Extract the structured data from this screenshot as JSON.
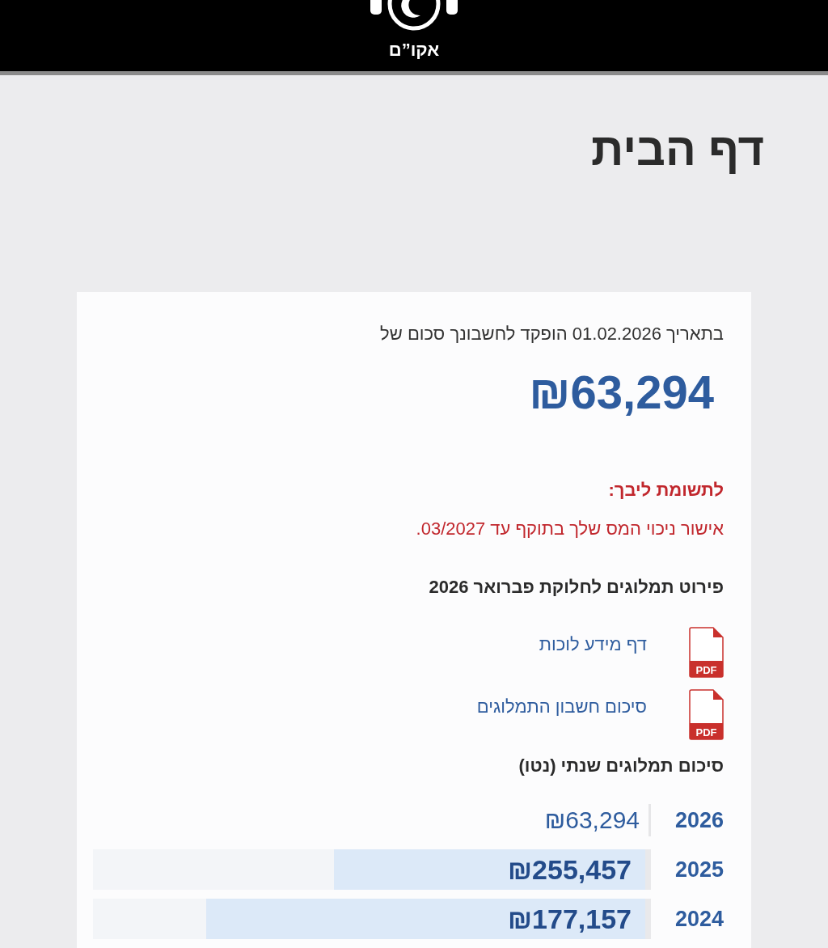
{
  "header": {
    "logo_text": "אקו”ם"
  },
  "page_title": "דף הבית",
  "deposit": {
    "text": "בתאריך 01.02.2026 הופקד לחשבונך סכום של",
    "amount": "₪63,294"
  },
  "notice": {
    "title": "לתשומת ליבך:",
    "text": "אישור ניכוי המס שלך בתוקף עד 03/2027."
  },
  "documents": {
    "title": "פירוט תמלוגים לחלוקת פברואר 2026",
    "items": [
      {
        "label": "דף מידע לוכות",
        "badge": "PDF"
      },
      {
        "label": "סיכום חשבון התמלוגים",
        "badge": "PDF"
      }
    ]
  },
  "annual": {
    "title": "סיכום תמלוגים שנתי (נטו)",
    "rows": [
      {
        "kind": "current",
        "year": "2026",
        "amount": "₪63,294"
      },
      {
        "kind": "bar",
        "year": "2025",
        "amount": "₪255,457",
        "level": 0.563
      },
      {
        "kind": "bar",
        "year": "2024",
        "amount": "₪177,157",
        "level": 0.795
      }
    ]
  }
}
